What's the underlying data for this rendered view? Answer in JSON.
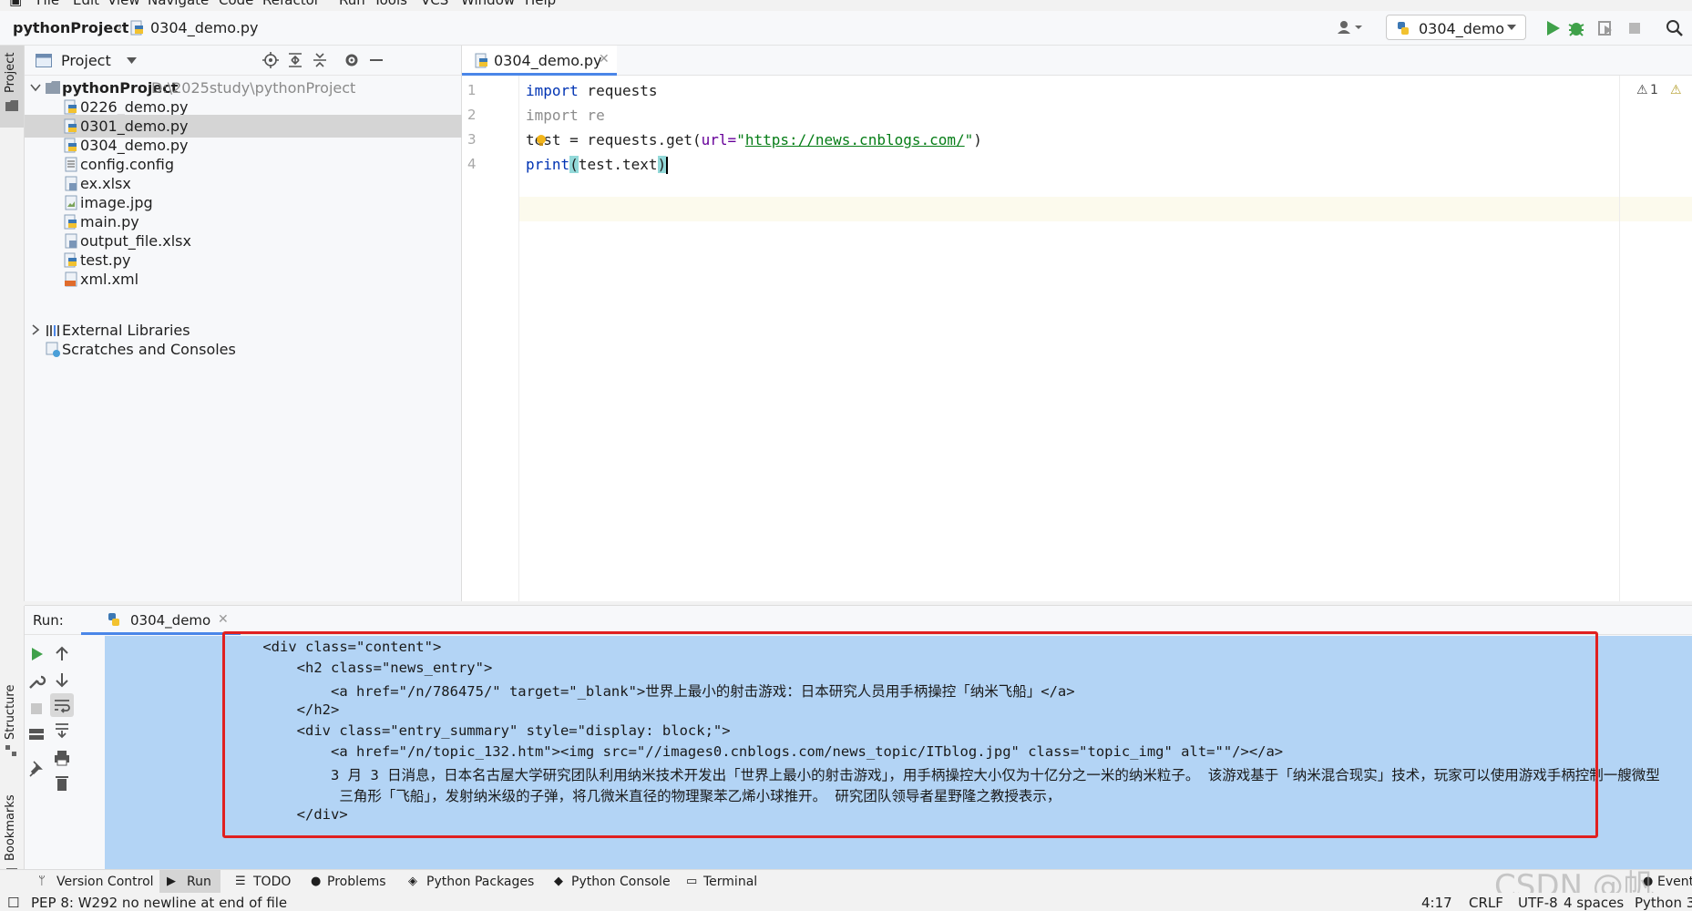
{
  "menu": [
    "File",
    "Edit",
    "View",
    "Navigate",
    "Code",
    "Refactor",
    "Run",
    "Tools",
    "VCS",
    "Window",
    "Help"
  ],
  "nav": {
    "project": "pythonProject",
    "file": "0304_demo.py",
    "run_config": "0304_demo"
  },
  "project_panel": {
    "title": "Project",
    "root_name": "pythonProject",
    "root_path": "D:\\2025study\\pythonProject",
    "files": [
      {
        "name": "0226_demo.py",
        "icon": "python-file-icon"
      },
      {
        "name": "0301_demo.py",
        "icon": "python-file-icon",
        "selected": true
      },
      {
        "name": "0304_demo.py",
        "icon": "python-file-icon"
      },
      {
        "name": "config.config",
        "icon": "text-file-icon"
      },
      {
        "name": "ex.xlsx",
        "icon": "spreadsheet-file-icon"
      },
      {
        "name": "image.jpg",
        "icon": "image-file-icon"
      },
      {
        "name": "main.py",
        "icon": "python-file-icon"
      },
      {
        "name": "output_file.xlsx",
        "icon": "spreadsheet-file-icon"
      },
      {
        "name": "test.py",
        "icon": "python-file-icon"
      },
      {
        "name": "xml.xml",
        "icon": "xml-file-icon"
      }
    ],
    "external_libraries": "External Libraries",
    "scratches": "Scratches and Consoles"
  },
  "editor": {
    "tab": "0304_demo.py",
    "line_numbers": [
      "1",
      "2",
      "3",
      "4"
    ],
    "code": {
      "l1_kw": "import",
      "l1_rest": " requests",
      "l2_kw": "import",
      "l2_rest": " re",
      "l3_a": "test = requests.get(",
      "l3_param": "url=",
      "l3_q1": "\"",
      "l3_url": "https://news.cnblogs.com/",
      "l3_q2": "\"",
      "l3_b": ")",
      "l4_fn": "print",
      "l4_open": "(",
      "l4_mid": "test.text",
      "l4_close": ")"
    },
    "warnings": "1"
  },
  "run": {
    "label": "Run:",
    "tab": "0304_demo",
    "console_lines": [
      "    <div class=\"content\">",
      "        <h2 class=\"news_entry\">",
      "            <a href=\"/n/786475/\" target=\"_blank\">世界上最小的射击游戏：日本研究人员用手柄操控「纳米飞船」</a>",
      "        </h2>",
      "        <div class=\"entry_summary\" style=\"display: block;\">",
      "            <a href=\"/n/topic_132.htm\"><img src=\"//images0.cnblogs.com/news_topic/ITblog.jpg\" class=\"topic_img\" alt=\"\"/></a>",
      "            3 月 3 日消息，日本名古屋大学研究团队利用纳米技术开发出「世界上最小的射击游戏」，用手柄操控大小仅为十亿分之一米的纳米粒子。 该游戏基于「纳米混合现实」技术，玩家可以使用游戏手柄控制一艘微型",
      "             三角形「飞船」，发射纳米级的子弹，将几微米直径的物理聚苯乙烯小球推开。 研究团队领导者星野隆之教授表示，",
      "        </div>"
    ]
  },
  "tool_tabs": [
    "Version Control",
    "Run",
    "TODO",
    "Problems",
    "Python Packages",
    "Python Console",
    "Terminal",
    "Event"
  ],
  "side_labels": {
    "project": "Project",
    "structure": "Structure",
    "bookmarks": "Bookmarks"
  },
  "status": {
    "message": "PEP 8: W292 no newline at end of file",
    "position": "4:17",
    "line_sep": "CRLF",
    "encoding": "UTF-8",
    "indent": "4 spaces",
    "interpreter": "Python 3"
  },
  "watermark": "CSDN @帆"
}
